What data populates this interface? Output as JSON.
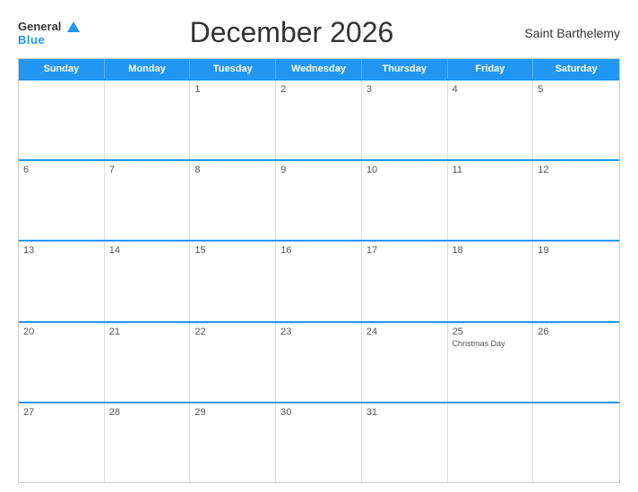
{
  "header": {
    "logo_general": "General",
    "logo_blue": "Blue",
    "title": "December 2026",
    "region": "Saint Barthelemy"
  },
  "days_of_week": [
    "Sunday",
    "Monday",
    "Tuesday",
    "Wednesday",
    "Thursday",
    "Friday",
    "Saturday"
  ],
  "weeks": [
    [
      {
        "num": "",
        "event": ""
      },
      {
        "num": "",
        "event": ""
      },
      {
        "num": "1",
        "event": ""
      },
      {
        "num": "2",
        "event": ""
      },
      {
        "num": "3",
        "event": ""
      },
      {
        "num": "4",
        "event": ""
      },
      {
        "num": "5",
        "event": ""
      }
    ],
    [
      {
        "num": "6",
        "event": ""
      },
      {
        "num": "7",
        "event": ""
      },
      {
        "num": "8",
        "event": ""
      },
      {
        "num": "9",
        "event": ""
      },
      {
        "num": "10",
        "event": ""
      },
      {
        "num": "11",
        "event": ""
      },
      {
        "num": "12",
        "event": ""
      }
    ],
    [
      {
        "num": "13",
        "event": ""
      },
      {
        "num": "14",
        "event": ""
      },
      {
        "num": "15",
        "event": ""
      },
      {
        "num": "16",
        "event": ""
      },
      {
        "num": "17",
        "event": ""
      },
      {
        "num": "18",
        "event": ""
      },
      {
        "num": "19",
        "event": ""
      }
    ],
    [
      {
        "num": "20",
        "event": ""
      },
      {
        "num": "21",
        "event": ""
      },
      {
        "num": "22",
        "event": ""
      },
      {
        "num": "23",
        "event": ""
      },
      {
        "num": "24",
        "event": ""
      },
      {
        "num": "25",
        "event": "Christmas Day"
      },
      {
        "num": "26",
        "event": ""
      }
    ],
    [
      {
        "num": "27",
        "event": ""
      },
      {
        "num": "28",
        "event": ""
      },
      {
        "num": "29",
        "event": ""
      },
      {
        "num": "30",
        "event": ""
      },
      {
        "num": "31",
        "event": ""
      },
      {
        "num": "",
        "event": ""
      },
      {
        "num": "",
        "event": ""
      }
    ]
  ]
}
